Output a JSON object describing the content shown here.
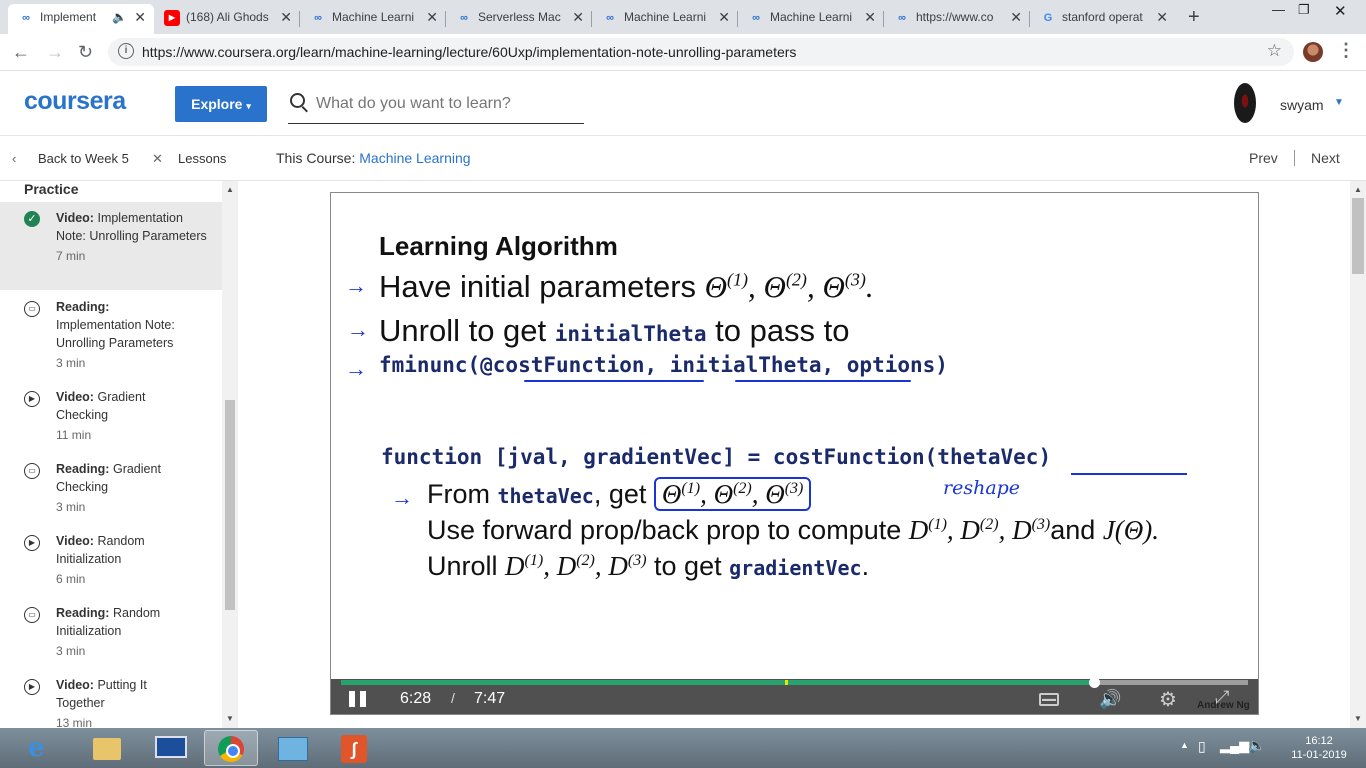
{
  "browser": {
    "tabs": [
      {
        "label": "Implement",
        "favicon": "coursera"
      },
      {
        "label": "(168) Ali Ghods",
        "favicon": "youtube"
      },
      {
        "label": "Machine Learni",
        "favicon": "coursera"
      },
      {
        "label": "Serverless Mac",
        "favicon": "coursera"
      },
      {
        "label": "Machine Learni",
        "favicon": "coursera"
      },
      {
        "label": "Machine Learni",
        "favicon": "coursera"
      },
      {
        "label": "https://www.co",
        "favicon": "coursera"
      },
      {
        "label": "stanford operat",
        "favicon": "google"
      }
    ],
    "url": "https://www.coursera.org/learn/machine-learning/lecture/60Uxp/implementation-note-unrolling-parameters"
  },
  "header": {
    "logo": "coursera",
    "explore_label": "Explore",
    "search_placeholder": "What do you want to learn?",
    "username": "swyam"
  },
  "crumbs": {
    "back_label": "Back to Week 5",
    "lessons_label": "Lessons",
    "course_prefix": "This Course:",
    "course_name": "Machine Learning",
    "prev_label": "Prev",
    "next_label": "Next"
  },
  "sidebar": {
    "section": "Practice",
    "items": [
      {
        "type": "Video:",
        "title": "Implementation Note: Unrolling Parameters",
        "duration": "7 min",
        "icon": "check-icon"
      },
      {
        "type": "Reading:",
        "title": "Implementation Note: Unrolling Parameters",
        "duration": "3 min",
        "icon": "book-icon"
      },
      {
        "type": "Video:",
        "title": "Gradient Checking",
        "duration": "11 min",
        "icon": "play-icon"
      },
      {
        "type": "Reading:",
        "title": "Gradient Checking",
        "duration": "3 min",
        "icon": "book-icon"
      },
      {
        "type": "Video:",
        "title": "Random Initialization",
        "duration": "6 min",
        "icon": "play-icon"
      },
      {
        "type": "Reading:",
        "title": "Random Initialization",
        "duration": "3 min",
        "icon": "book-icon"
      },
      {
        "type": "Video:",
        "title": "Putting It Together",
        "duration": "13 min",
        "icon": "play-icon"
      }
    ]
  },
  "video": {
    "slide_title": "Learning Algorithm",
    "line1": "Have initial parameters",
    "line2a": "Unroll to get",
    "line2_code": "initialTheta",
    "line2b": "to pass to",
    "line3_code": "fminunc(@costFunction, initialTheta, options)",
    "func_line": "function [jval, gradientVec] = costFunction(thetaVec)",
    "from_a": "From",
    "from_code": "thetaVec",
    "from_b": ", get",
    "annotation": "reshape",
    "use_line": "Use forward prop/back prop to compute",
    "use_and": "and",
    "unroll_a": "Unroll",
    "unroll_b": "to get",
    "unroll_code": "gradientVec",
    "time_current": "6:28",
    "time_separator": "/",
    "time_total": "7:47",
    "progress_fraction": 0.83,
    "credit": "Andrew Ng"
  },
  "taskbar": {
    "time": "16:12",
    "date": "11-01-2019"
  }
}
